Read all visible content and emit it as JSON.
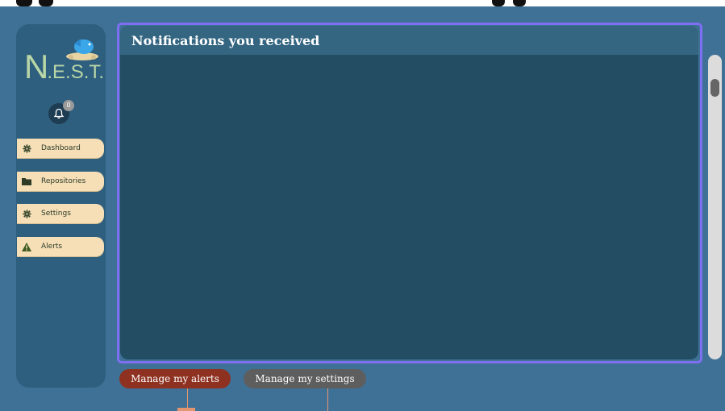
{
  "logo": {
    "main": "N",
    "small": ".E.S.T."
  },
  "notifications": {
    "count": "0"
  },
  "sidebar": {
    "items": [
      {
        "label": "Dashboard",
        "icon": "gear-icon"
      },
      {
        "label": "Repositories",
        "icon": "folder-icon"
      },
      {
        "label": "Settings",
        "icon": "gear-icon"
      },
      {
        "label": "Alerts",
        "icon": "warning-icon"
      }
    ]
  },
  "main": {
    "title": "Notifications you received"
  },
  "actions": {
    "alerts_label": "Manage my alerts",
    "settings_label": "Manage my settings"
  },
  "colors": {
    "background": "#3f7197",
    "sidebar": "#2f5f7e",
    "nav_item": "#f6dfb6",
    "panel": "#224d63",
    "panel_header": "#346681",
    "panel_outline": "#7d6ff0",
    "alerts_button": "#8e3121",
    "settings_button": "#5e5e5e"
  }
}
